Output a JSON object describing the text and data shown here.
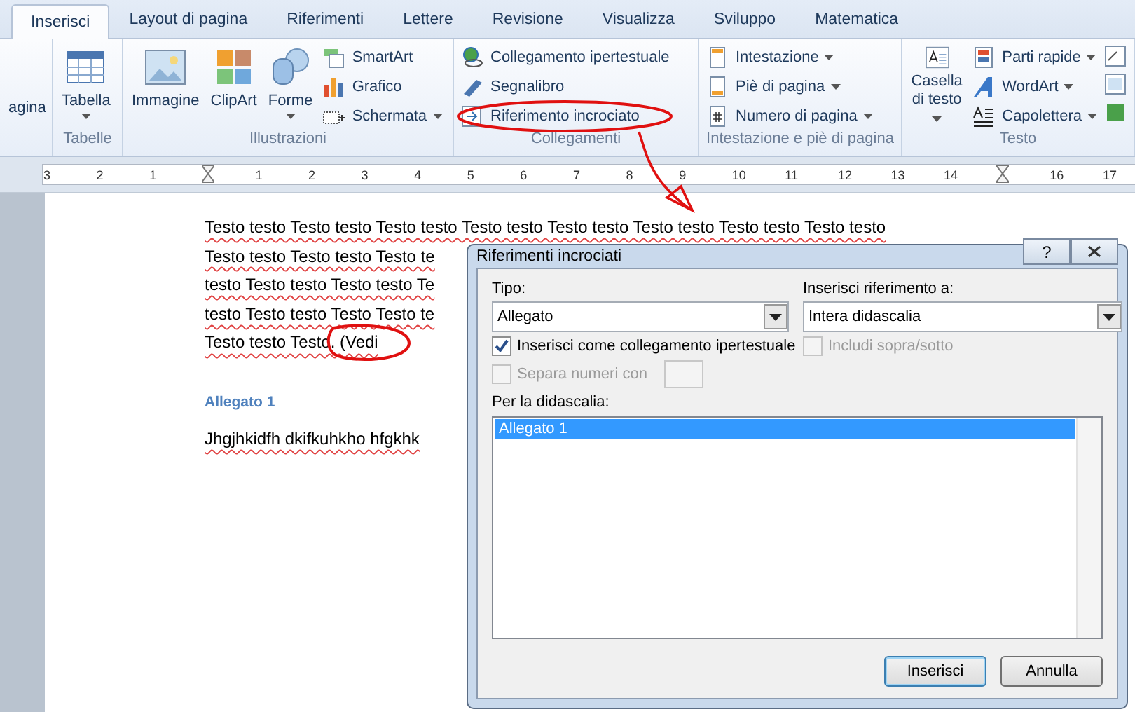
{
  "tabs": [
    {
      "label": "Inserisci",
      "selected": true
    },
    {
      "label": "Layout di pagina",
      "selected": false
    },
    {
      "label": "Riferimenti",
      "selected": false
    },
    {
      "label": "Lettere",
      "selected": false
    },
    {
      "label": "Revisione",
      "selected": false
    },
    {
      "label": "Visualizza",
      "selected": false
    },
    {
      "label": "Sviluppo",
      "selected": false
    },
    {
      "label": "Matematica",
      "selected": false
    }
  ],
  "ribbon": [
    {
      "buttons": [
        {
          "kind": "large",
          "label": "agina",
          "menu": false
        }
      ]
    },
    {
      "label": "Tabelle",
      "buttons": [
        {
          "kind": "large",
          "label": "Tabella",
          "menu": true
        }
      ]
    },
    {
      "label": "Illustrazioni",
      "buttons": [
        {
          "kind": "large",
          "label": "Immagine",
          "menu": false
        },
        {
          "kind": "large",
          "label": "ClipArt",
          "menu": false
        },
        {
          "kind": "large",
          "label": "Forme",
          "menu": true
        },
        {
          "kind": "small",
          "label": "SmartArt",
          "menu": false
        },
        {
          "kind": "small",
          "label": "Grafico",
          "menu": false
        },
        {
          "kind": "small",
          "label": "Schermata",
          "menu": true
        }
      ]
    },
    {
      "label": "Collegamenti",
      "buttons": [
        {
          "kind": "small",
          "label": "Collegamento ipertestuale",
          "menu": false
        },
        {
          "kind": "small",
          "label": "Segnalibro",
          "menu": false
        },
        {
          "kind": "small",
          "label": "Riferimento incrociato",
          "menu": false
        }
      ]
    },
    {
      "label": "Intestazione e piè di pagina",
      "buttons": [
        {
          "kind": "small",
          "label": "Intestazione",
          "menu": true
        },
        {
          "kind": "small",
          "label": "Piè di pagina",
          "menu": true
        },
        {
          "kind": "small",
          "label": "Numero di pagina",
          "menu": true
        }
      ]
    },
    {
      "label": "Testo",
      "buttons": [
        {
          "kind": "large",
          "label": "Casella di testo",
          "menu": true
        },
        {
          "kind": "small",
          "label": "Parti rapide",
          "menu": true
        },
        {
          "kind": "small",
          "label": "WordArt",
          "menu": true
        },
        {
          "kind": "small",
          "label": "Capolettera",
          "menu": true
        }
      ]
    }
  ],
  "ruler": [
    {
      "kind": "number",
      "text": "3"
    },
    {
      "kind": "number",
      "text": "2"
    },
    {
      "kind": "number",
      "text": "1"
    },
    {
      "kind": "marker"
    },
    {
      "kind": "number",
      "text": "1"
    },
    {
      "kind": "number",
      "text": "2"
    },
    {
      "kind": "number",
      "text": "3"
    },
    {
      "kind": "number",
      "text": "4"
    },
    {
      "kind": "number",
      "text": "5"
    },
    {
      "kind": "number",
      "text": "6"
    },
    {
      "kind": "number",
      "text": "7"
    },
    {
      "kind": "number",
      "text": "8"
    },
    {
      "kind": "number",
      "text": "9"
    },
    {
      "kind": "number",
      "text": "10"
    },
    {
      "kind": "number",
      "text": "11"
    },
    {
      "kind": "number",
      "text": "12"
    },
    {
      "kind": "number",
      "text": "13"
    },
    {
      "kind": "number",
      "text": "14"
    },
    {
      "kind": "marker"
    },
    {
      "kind": "number",
      "text": "16"
    },
    {
      "kind": "number",
      "text": "17"
    }
  ],
  "document": {
    "paragraph": [
      "Testo testo Testo testo Testo testo Testo testo Testo testo Testo testo Testo testo Testo testo",
      "Testo testo Testo testo Testo te",
      "testo Testo testo Testo testo Te",
      "testo Testo testo Testo Testo te",
      "Testo testo Testo. (Vedi"
    ],
    "heading": "Allegato 1",
    "body": "Jhgjhkidfh dkifkuhkho hfgkhk"
  },
  "dialog": {
    "title": "Riferimenti incrociati",
    "help": "?",
    "type_label": "Tipo:",
    "type_value": "Allegato",
    "ref_label": "Inserisci riferimento a:",
    "ref_value": "Intera didascalia",
    "options": [
      {
        "label": "Inserisci come collegamento ipertestuale",
        "checked": true,
        "disabled": false
      },
      {
        "label": "Includi sopra/sotto",
        "checked": false,
        "disabled": true
      },
      {
        "label": "Separa numeri con",
        "checked": false,
        "disabled": true
      }
    ],
    "list_label": "Per la didascalia:",
    "items": [
      {
        "label": "Allegato 1",
        "selected": true
      }
    ],
    "buttons": [
      {
        "label": "Inserisci",
        "default": true
      },
      {
        "label": "Annulla",
        "default": false
      }
    ]
  }
}
